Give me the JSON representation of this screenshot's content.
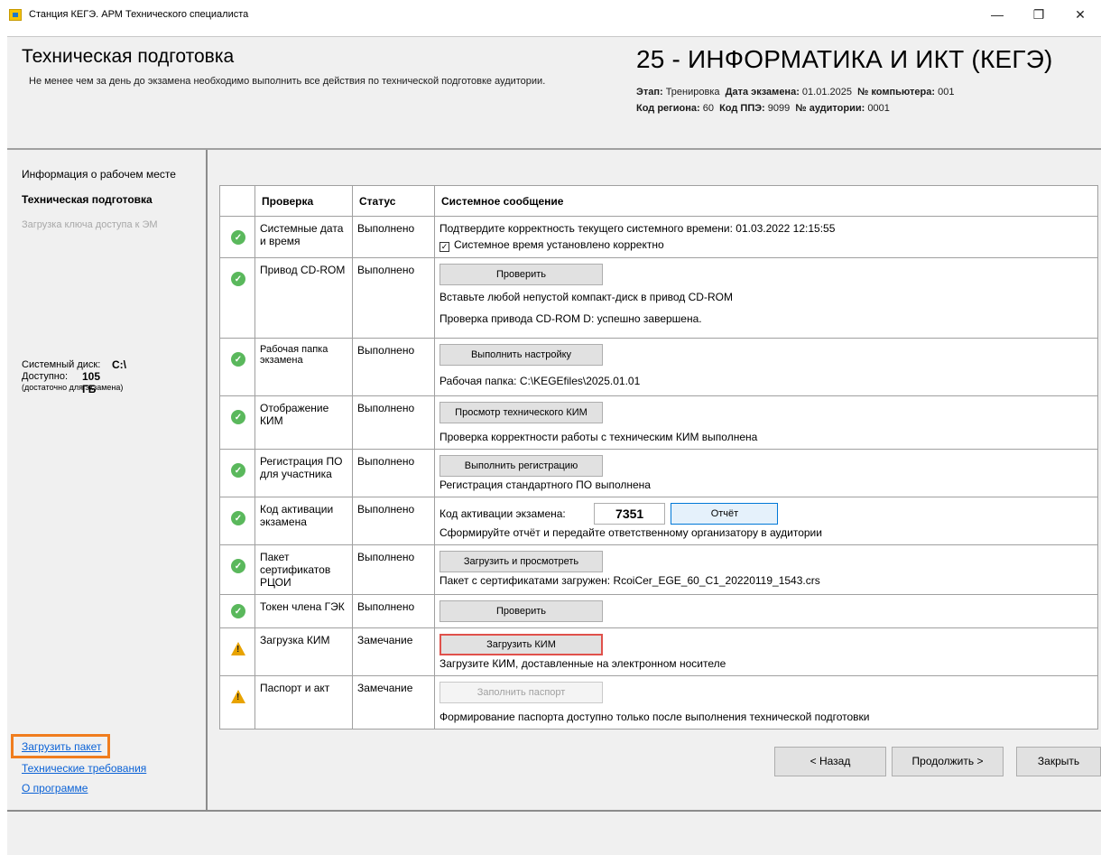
{
  "window": {
    "title": "Станция КЕГЭ. АРМ Технического специалиста"
  },
  "header": {
    "title": "Техническая подготовка",
    "subtitle": "Не менее чем за день до экзамена необходимо выполнить все действия по технической подготовке аудитории.",
    "subject": "25 - ИНФОРМАТИКА И ИКТ (КЕГЭ)",
    "stage_label": "Этап:",
    "stage": "Тренировка",
    "exam_date_label": "Дата экзамена:",
    "exam_date": "01.01.2025",
    "computer_label": "№ компьютера:",
    "computer": "001",
    "region_label": "Код региона:",
    "region": "60",
    "ppe_label": "Код ППЭ:",
    "ppe": "9099",
    "room_label": "№ аудитории:",
    "room": "0001"
  },
  "sidebar": {
    "items": [
      {
        "label": "Информация о рабочем месте"
      },
      {
        "label": "Техническая подготовка"
      },
      {
        "label": "Загрузка ключа доступа к ЭМ"
      }
    ],
    "disk_label": "Системный диск:",
    "disk_value": "C:\\",
    "free_label": "Доступно:",
    "free_value": "105 ГБ",
    "free_note": "(достаточно для экзамена)",
    "links": [
      {
        "label": "Загрузить пакет"
      },
      {
        "label": "Технические требования"
      },
      {
        "label": "О программе"
      }
    ]
  },
  "table": {
    "headers": [
      "Проверка",
      "Статус",
      "Системное сообщение"
    ],
    "rows": [
      {
        "status_icon": "check-icon",
        "check": "Системные дата и время",
        "status": "Выполнено",
        "message": "Подтвердите корректность текущего системного времени: 01.03.2022 12:15:55",
        "checkbox_label": "Системное время установлено корректно"
      },
      {
        "status_icon": "check-icon",
        "check": "Привод CD-ROM",
        "status": "Выполнено",
        "button": "Проверить",
        "message": "Вставьте любой непустой компакт-диск в привод CD-ROM",
        "message2": "Проверка привода CD-ROM D: успешно завершена."
      },
      {
        "status_icon": "check-icon",
        "check": "Рабочая папка экзамена",
        "status": "Выполнено",
        "button": "Выполнить настройку",
        "message": "Рабочая папка: C:\\KEGEfiles\\2025.01.01"
      },
      {
        "status_icon": "check-icon",
        "check": "Отображение КИМ",
        "status": "Выполнено",
        "button": "Просмотр технического КИМ",
        "message": "Проверка корректности работы с техническим КИМ выполнена"
      },
      {
        "status_icon": "check-icon",
        "check": "Регистрация ПО для участника",
        "status": "Выполнено",
        "button": "Выполнить регистрацию",
        "message": "Регистрация стандартного ПО выполнена"
      },
      {
        "status_icon": "check-icon",
        "check": "Код активации экзамена",
        "status": "Выполнено",
        "code_label": "Код активации экзамена:",
        "code": "7351",
        "button": "Отчёт",
        "message": "Сформируйте отчёт и передайте ответственному организатору в аудитории"
      },
      {
        "status_icon": "check-icon",
        "check": "Пакет сертификатов РЦОИ",
        "status": "Выполнено",
        "button": "Загрузить и просмотреть",
        "message": "Пакет с сертификатами загружен: RcoiCer_EGE_60_C1_20220119_1543.crs"
      },
      {
        "status_icon": "check-icon",
        "check": "Токен члена ГЭК",
        "status": "Выполнено",
        "button": "Проверить"
      },
      {
        "status_icon": "warning-icon",
        "check": "Загрузка КИМ",
        "status": "Замечание",
        "button": "Загрузить КИМ",
        "message": "Загрузите КИМ, доставленные на электронном носителе"
      },
      {
        "status_icon": "warning-icon",
        "check": "Паспорт и акт",
        "status": "Замечание",
        "button": "Заполнить паспорт",
        "message": "Формирование паспорта доступно только после выполнения технической подготовки"
      }
    ]
  },
  "footer": {
    "back": "< Назад",
    "next": "Продолжить >",
    "close": "Закрыть"
  },
  "colors": {
    "ok": "#5ab85c",
    "warn": "#e8a300",
    "link": "#0b62d6",
    "highlight": "#f07d1e"
  }
}
